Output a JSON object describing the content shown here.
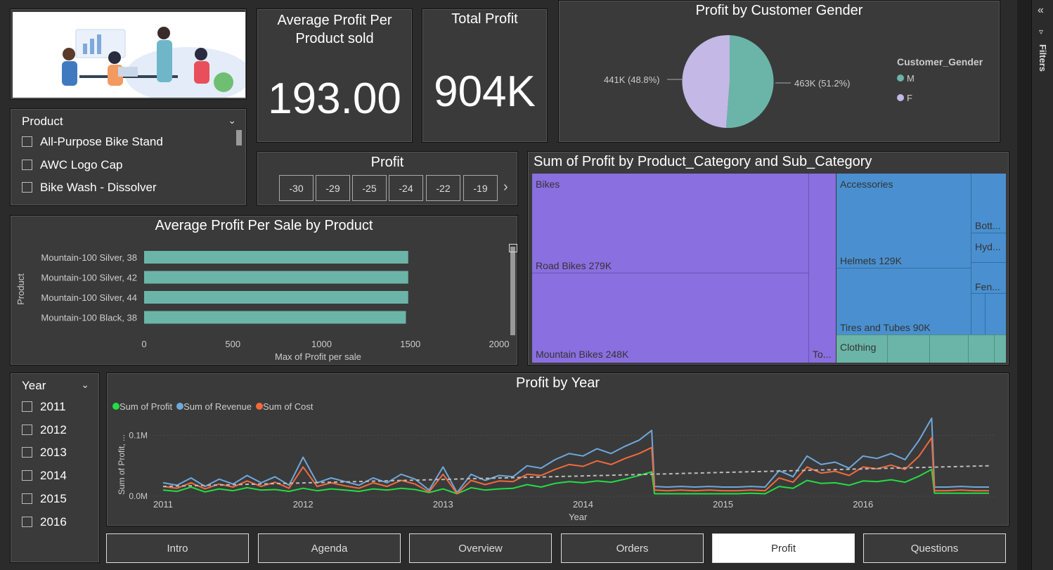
{
  "kpi": {
    "avg_profit_title": "Average Profit Per Product sold",
    "avg_profit_value": "193.00",
    "total_profit_title": "Total Profit",
    "total_profit_value": "904K"
  },
  "gender_chart": {
    "title": "Profit by Customer Gender",
    "legend_title": "Customer_Gender",
    "legend_items": [
      "M",
      "F"
    ],
    "label_f": "441K (48.8%)",
    "label_m": "463K (51.2%)",
    "colors": {
      "M": "#6bb5a8",
      "F": "#c4b8e6"
    }
  },
  "product_slicer": {
    "title": "Product",
    "items": [
      "All-Purpose Bike Stand",
      "AWC Logo Cap",
      "Bike Wash - Dissolver"
    ]
  },
  "profit_slicer": {
    "title": "Profit",
    "values": [
      "-30",
      "-29",
      "-25",
      "-24",
      "-22",
      "-19"
    ]
  },
  "treemap": {
    "title": "Sum of Profit by Product_Category and Sub_Category",
    "bikes": "Bikes",
    "road": "Road Bikes 279K",
    "mountain": "Mountain Bikes 248K",
    "touring": "To...",
    "accessories": "Accessories",
    "helmets": "Helmets 129K",
    "tires": "Tires and Tubes 90K",
    "bottles": "Bott...",
    "hydration": "Hyd...",
    "fenders": "Fen...",
    "clothing": "Clothing"
  },
  "bar_chart": {
    "title": "Average Profit Per Sale by Product",
    "ylabel": "Product",
    "xlabel": "Max of Profit per sale",
    "ticks": [
      "0",
      "500",
      "1000",
      "1500",
      "2000"
    ]
  },
  "year_slicer": {
    "title": "Year",
    "items": [
      "2011",
      "2012",
      "2013",
      "2014",
      "2015",
      "2016"
    ]
  },
  "line_chart": {
    "title": "Profit by Year",
    "legend": [
      "Sum of Profit",
      "Sum of Revenue",
      "Sum of Cost"
    ],
    "ylabel": "Sum of Profit, ...",
    "xlabel": "Year",
    "yticks": [
      "0.1M",
      "0.0M"
    ],
    "xticks": [
      "2011",
      "2012",
      "2013",
      "2014",
      "2015",
      "2016"
    ]
  },
  "nav": {
    "buttons": [
      "Intro",
      "Agenda",
      "Overview",
      "Orders",
      "Profit",
      "Questions"
    ],
    "active": "Profit"
  },
  "filters_pane": {
    "label": "Filters"
  },
  "chart_data": [
    {
      "type": "pie",
      "title": "Profit by Customer Gender",
      "labels": [
        "M",
        "F"
      ],
      "values": [
        463,
        441
      ],
      "percent": [
        51.2,
        48.8
      ],
      "unit": "K",
      "legend": "right",
      "colors": [
        "#6bb5a8",
        "#c4b8e6"
      ]
    },
    {
      "type": "bar",
      "title": "Average Profit Per Sale by Product",
      "orientation": "horizontal",
      "categories": [
        "Mountain-100 Silver, 38",
        "Mountain-100 Silver, 42",
        "Mountain-100 Silver, 44",
        "Mountain-100 Black, 38"
      ],
      "values": [
        1488,
        1488,
        1488,
        1475
      ],
      "xlabel": "Max of Profit per sale",
      "ylabel": "Product",
      "xlim": [
        0,
        2000
      ],
      "color": "#6bb5a8"
    },
    {
      "type": "line",
      "title": "Profit by Year",
      "xlabel": "Year",
      "ylabel": "Sum of Profit, ...",
      "xlim": [
        2011,
        2016.95
      ],
      "ylim": [
        0,
        0.15
      ],
      "legend": "top-left",
      "series": [
        {
          "name": "Sum of Profit",
          "color": "#22dd44",
          "x": [
            2011,
            2011.1,
            2011.2,
            2011.3,
            2011.4,
            2011.5,
            2011.6,
            2011.7,
            2011.8,
            2011.9,
            2012,
            2012.1,
            2012.2,
            2012.3,
            2012.4,
            2012.5,
            2012.6,
            2012.7,
            2012.8,
            2012.9,
            2013,
            2013.1,
            2013.2,
            2013.3,
            2013.4,
            2013.5,
            2013.6,
            2013.7,
            2013.8,
            2013.9,
            2014,
            2014.1,
            2014.2,
            2014.3,
            2014.4,
            2014.49,
            2014.51,
            2014.6,
            2014.7,
            2014.8,
            2014.9,
            2015,
            2015.1,
            2015.2,
            2015.3,
            2015.4,
            2015.5,
            2015.6,
            2015.7,
            2015.8,
            2015.9,
            2016,
            2016.1,
            2016.2,
            2016.3,
            2016.4,
            2016.49,
            2016.51,
            2016.6,
            2016.7,
            2016.8,
            2016.9
          ],
          "y": [
            0.01,
            0.008,
            0.015,
            0.007,
            0.012,
            0.009,
            0.014,
            0.01,
            0.011,
            0.008,
            0.013,
            0.009,
            0.012,
            0.01,
            0.008,
            0.012,
            0.01,
            0.013,
            0.011,
            0.006,
            0.012,
            0.004,
            0.014,
            0.01,
            0.012,
            0.013,
            0.019,
            0.015,
            0.021,
            0.024,
            0.022,
            0.025,
            0.023,
            0.028,
            0.034,
            0.04,
            0.004,
            0.004,
            0.004,
            0.004,
            0.004,
            0.004,
            0.004,
            0.005,
            0.004,
            0.016,
            0.013,
            0.026,
            0.021,
            0.022,
            0.018,
            0.025,
            0.024,
            0.027,
            0.023,
            0.033,
            0.044,
            0.005,
            0.005,
            0.005,
            0.005,
            0.005
          ]
        },
        {
          "name": "Sum of Revenue",
          "color": "#6ea8dc",
          "x": [
            2011,
            2011.1,
            2011.2,
            2011.3,
            2011.4,
            2011.5,
            2011.6,
            2011.7,
            2011.8,
            2011.9,
            2012,
            2012.1,
            2012.2,
            2012.3,
            2012.4,
            2012.5,
            2012.6,
            2012.7,
            2012.8,
            2012.9,
            2013,
            2013.1,
            2013.2,
            2013.3,
            2013.4,
            2013.5,
            2013.6,
            2013.7,
            2013.8,
            2013.9,
            2014,
            2014.1,
            2014.2,
            2014.3,
            2014.4,
            2014.49,
            2014.51,
            2014.6,
            2014.7,
            2014.8,
            2014.9,
            2015,
            2015.1,
            2015.2,
            2015.3,
            2015.4,
            2015.5,
            2015.6,
            2015.7,
            2015.8,
            2015.9,
            2016,
            2016.1,
            2016.2,
            2016.3,
            2016.4,
            2016.49,
            2016.51,
            2016.6,
            2016.7,
            2016.8,
            2016.9
          ],
          "y": [
            0.022,
            0.018,
            0.03,
            0.016,
            0.028,
            0.02,
            0.034,
            0.022,
            0.032,
            0.018,
            0.064,
            0.022,
            0.03,
            0.024,
            0.018,
            0.03,
            0.022,
            0.036,
            0.028,
            0.01,
            0.048,
            0.006,
            0.036,
            0.026,
            0.034,
            0.032,
            0.05,
            0.046,
            0.06,
            0.07,
            0.066,
            0.078,
            0.07,
            0.082,
            0.092,
            0.108,
            0.016,
            0.015,
            0.016,
            0.015,
            0.016,
            0.015,
            0.015,
            0.016,
            0.015,
            0.042,
            0.032,
            0.066,
            0.052,
            0.056,
            0.046,
            0.066,
            0.062,
            0.07,
            0.06,
            0.092,
            0.128,
            0.015,
            0.015,
            0.016,
            0.015,
            0.015
          ]
        },
        {
          "name": "Sum of Cost",
          "color": "#f06a3c",
          "x": [
            2011,
            2011.1,
            2011.2,
            2011.3,
            2011.4,
            2011.5,
            2011.6,
            2011.7,
            2011.8,
            2011.9,
            2012,
            2012.1,
            2012.2,
            2012.3,
            2012.4,
            2012.5,
            2012.6,
            2012.7,
            2012.8,
            2012.9,
            2013,
            2013.1,
            2013.2,
            2013.3,
            2013.4,
            2013.5,
            2013.6,
            2013.7,
            2013.8,
            2013.9,
            2014,
            2014.1,
            2014.2,
            2014.3,
            2014.4,
            2014.49,
            2014.51,
            2014.6,
            2014.7,
            2014.8,
            2014.9,
            2015,
            2015.1,
            2015.2,
            2015.3,
            2015.4,
            2015.5,
            2015.6,
            2015.7,
            2015.8,
            2015.9,
            2016,
            2016.1,
            2016.2,
            2016.3,
            2016.4,
            2016.49,
            2016.51,
            2016.6,
            2016.7,
            2016.8,
            2016.9
          ],
          "y": [
            0.016,
            0.013,
            0.022,
            0.012,
            0.02,
            0.015,
            0.025,
            0.016,
            0.023,
            0.013,
            0.048,
            0.016,
            0.022,
            0.017,
            0.013,
            0.022,
            0.016,
            0.026,
            0.02,
            0.007,
            0.036,
            0.004,
            0.026,
            0.019,
            0.025,
            0.024,
            0.036,
            0.034,
            0.044,
            0.052,
            0.049,
            0.058,
            0.052,
            0.062,
            0.07,
            0.08,
            0.01,
            0.009,
            0.01,
            0.009,
            0.01,
            0.009,
            0.009,
            0.01,
            0.009,
            0.03,
            0.023,
            0.048,
            0.038,
            0.041,
            0.034,
            0.048,
            0.045,
            0.051,
            0.044,
            0.066,
            0.096,
            0.009,
            0.009,
            0.01,
            0.009,
            0.009
          ]
        },
        {
          "name": "",
          "color": "#bbbbbb",
          "style": "dashed",
          "x": [
            2011,
            2016.9
          ],
          "y": [
            0.016,
            0.05
          ]
        }
      ]
    },
    {
      "type": "treemap",
      "title": "Sum of Profit by Product_Category and Sub_Category",
      "groups": [
        {
          "name": "Bikes",
          "children": [
            {
              "name": "Road Bikes",
              "value": 279
            },
            {
              "name": "Mountain Bikes",
              "value": 248
            },
            {
              "name": "To...",
              "value": 50
            }
          ]
        },
        {
          "name": "Accessories",
          "children": [
            {
              "name": "Helmets",
              "value": 129
            },
            {
              "name": "Tires and Tubes",
              "value": 90
            },
            {
              "name": "Bott...",
              "value": 20
            },
            {
              "name": "Hyd...",
              "value": 13
            },
            {
              "name": "Fen...",
              "value": 12
            }
          ]
        },
        {
          "name": "Clothing",
          "children": []
        }
      ],
      "unit": "K"
    }
  ]
}
